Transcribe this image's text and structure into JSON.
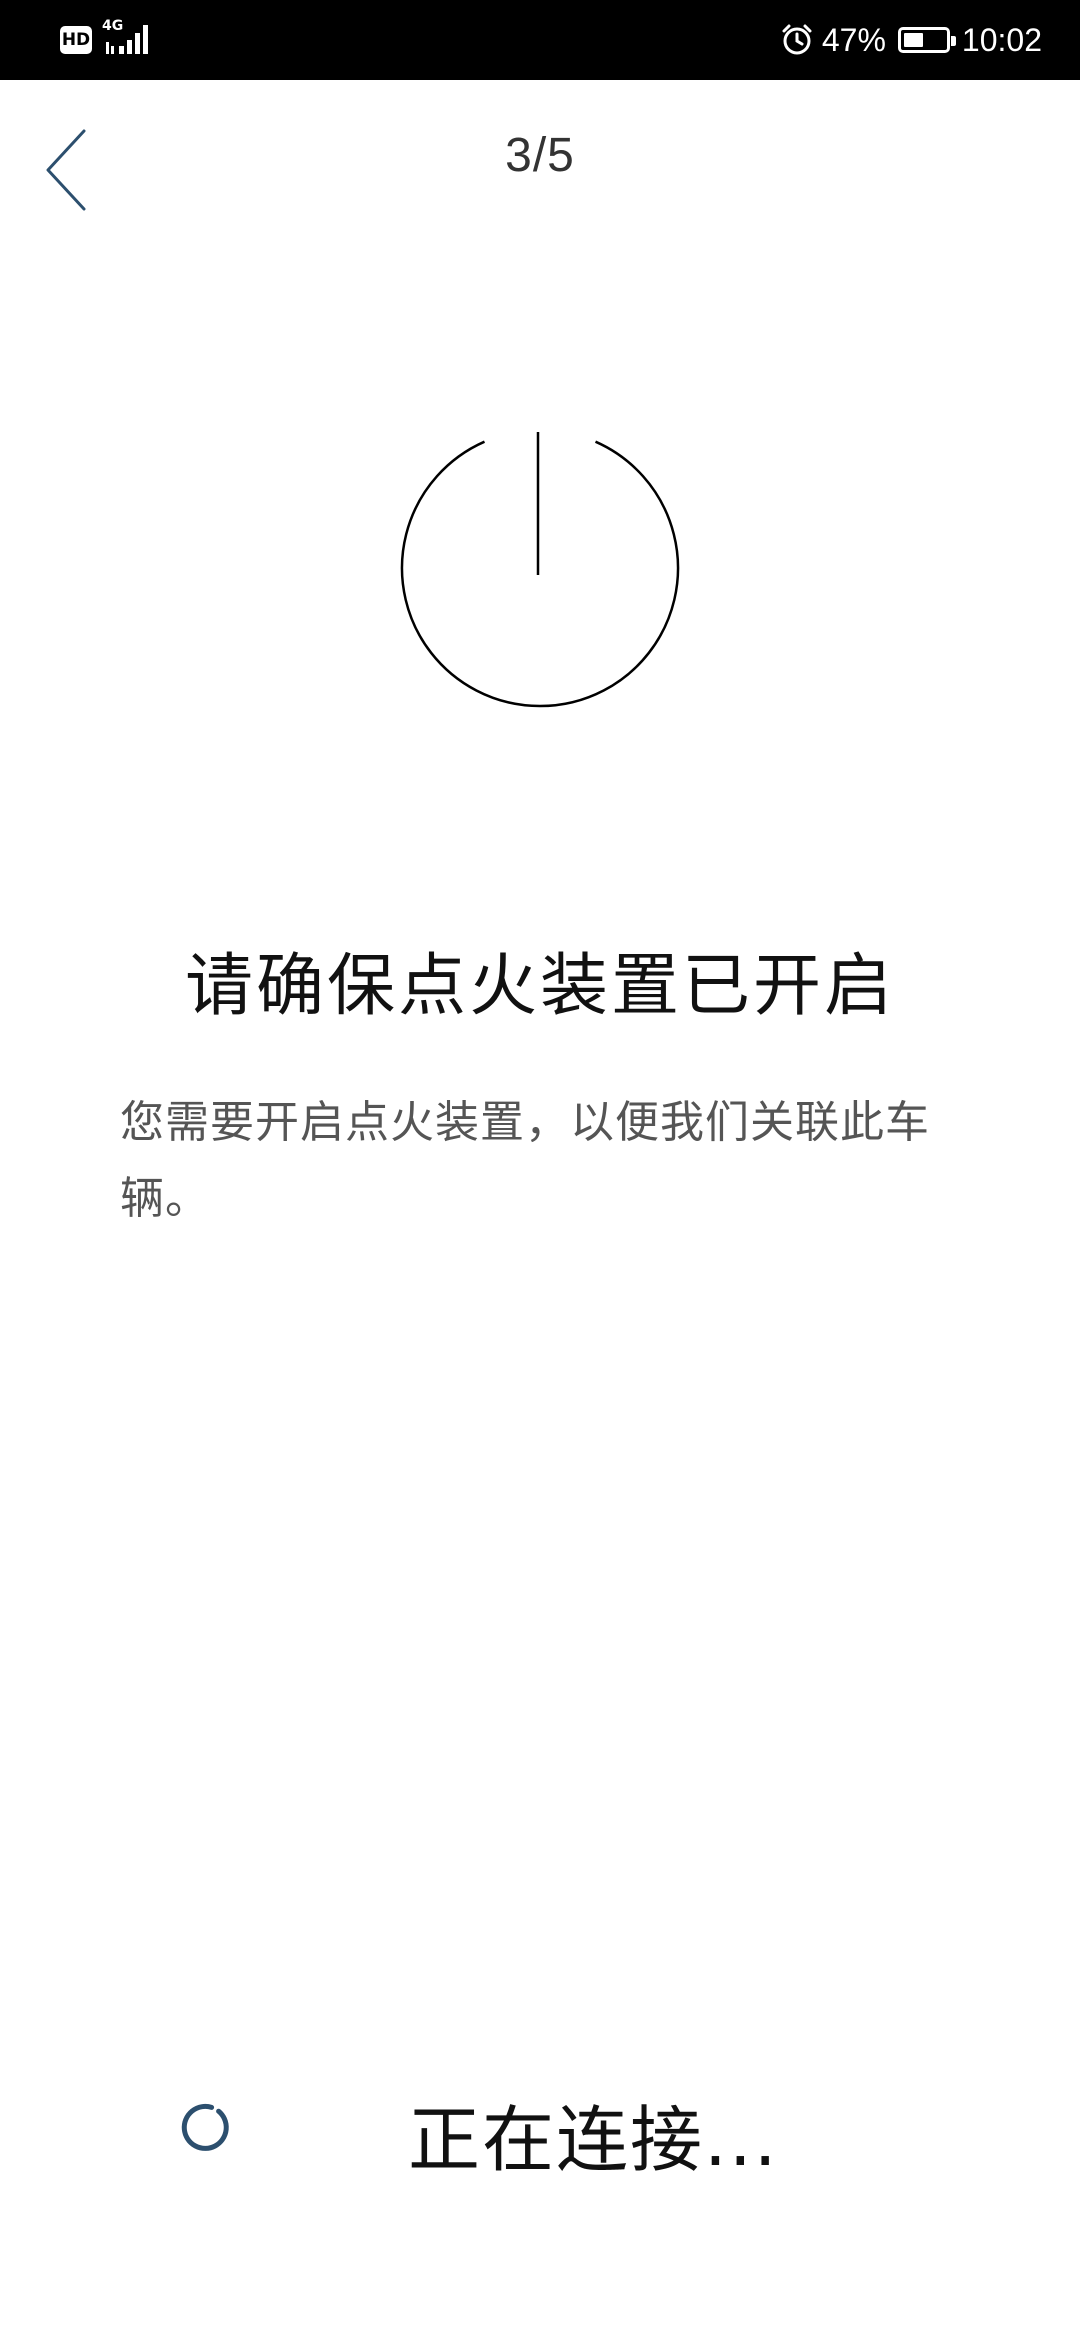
{
  "status_bar": {
    "hd": "HD",
    "network": "4G",
    "battery_percent": "47%",
    "battery_level": 0.47,
    "time": "10:02"
  },
  "header": {
    "step": "3/5"
  },
  "content": {
    "title": "请确保点火装置已开启",
    "description": "您需要开启点火装置，以便我们关联此车辆。"
  },
  "footer": {
    "status_text": "正在连接..."
  },
  "colors": {
    "accent": "#2c4f6e"
  },
  "icons": {
    "back": "chevron-left-icon",
    "power": "power-icon",
    "spinner": "loading-spinner-icon"
  }
}
